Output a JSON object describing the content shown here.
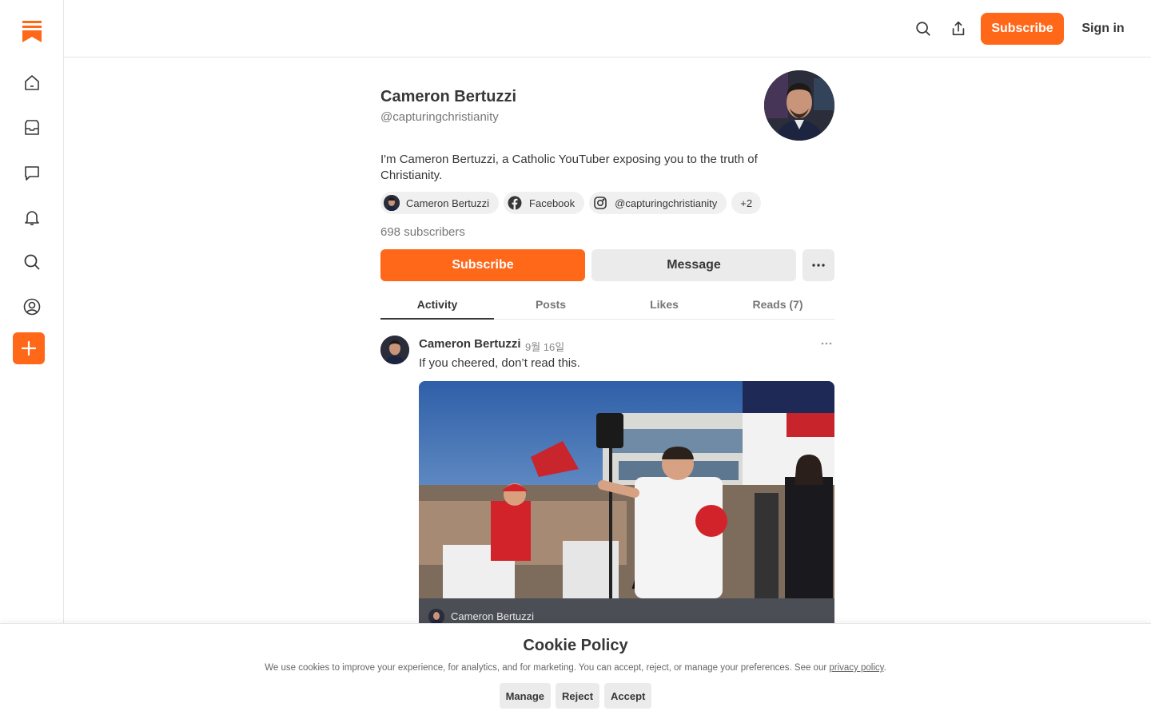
{
  "topbar": {
    "subscribe_label": "Subscribe",
    "signin_label": "Sign in"
  },
  "sidebar": {
    "items": [
      "home",
      "inbox",
      "chat",
      "activity",
      "search",
      "profile"
    ],
    "accent": "#ff6719"
  },
  "profile": {
    "name": "Cameron Bertuzzi",
    "handle": "@capturingchristianity",
    "bio": "I'm Cameron Bertuzzi, a Catholic YouTuber exposing you to the truth of Christianity.",
    "links": [
      {
        "label": "Cameron Bertuzzi",
        "icon": "avatar-icon"
      },
      {
        "label": "Facebook",
        "icon": "facebook-icon"
      },
      {
        "label": "@capturingchristianity",
        "icon": "instagram-icon"
      }
    ],
    "more_links": "+2",
    "subscribers": "698 subscribers",
    "subscribe_label": "Subscribe",
    "message_label": "Message"
  },
  "tabs": [
    {
      "label": "Activity",
      "active": true
    },
    {
      "label": "Posts",
      "active": false
    },
    {
      "label": "Likes",
      "active": false
    },
    {
      "label": "Reads (7)",
      "active": false
    }
  ],
  "post": {
    "author": "Cameron Bertuzzi",
    "date": "9월 16일",
    "text": "If you cheered, don’t read this.",
    "card_author": "Cameron Bertuzzi"
  },
  "cookie": {
    "title": "Cookie Policy",
    "text": "We use cookies to improve your experience, for analytics, and for marketing. You can accept, reject, or manage your preferences. See our",
    "link": "privacy policy",
    "period": ".",
    "manage": "Manage",
    "reject": "Reject",
    "accept": "Accept"
  }
}
